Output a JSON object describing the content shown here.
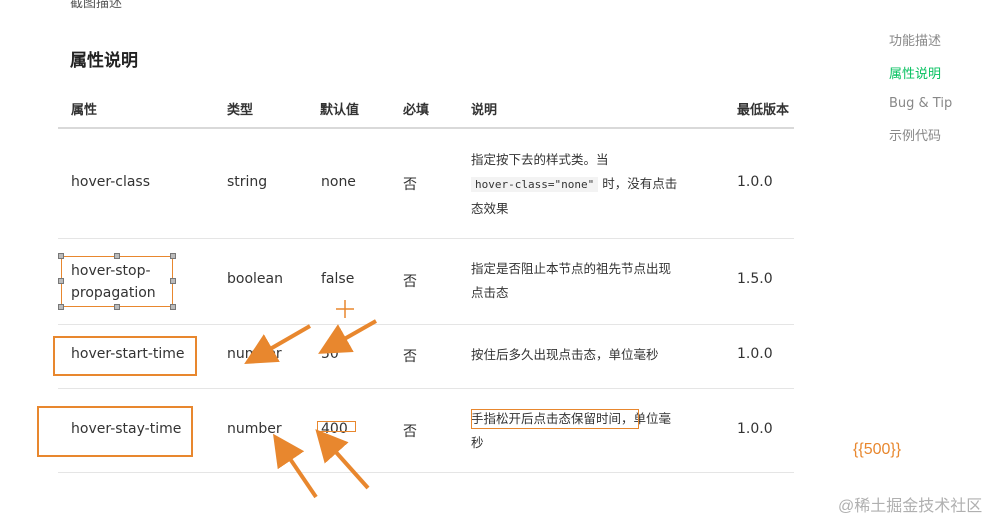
{
  "page": {
    "top_cut_text": "截图描述",
    "section_title": "属性说明"
  },
  "table": {
    "headers": [
      "属性",
      "类型",
      "默认值",
      "必填",
      "说明",
      "最低版本"
    ],
    "rows": [
      {
        "attr": "hover-class",
        "type": "string",
        "default": "none",
        "required": "否",
        "desc_pre": "指定按下去的样式类。当",
        "desc_code": "hover-class=\"none\"",
        "desc_mid": " 时，没有点击",
        "desc_post": "态效果",
        "version": "1.0.0"
      },
      {
        "attr_line1": "hover-stop-",
        "attr_line2": "propagation",
        "type": "boolean",
        "default": "false",
        "required": "否",
        "desc_line1": "指定是否阻止本节点的祖先节点出现",
        "desc_line2": "点击态",
        "version": "1.5.0"
      },
      {
        "attr": "hover-start-time",
        "type": "number",
        "default": "50",
        "required": "否",
        "desc_line1": "按住后多久出现点击态，单位毫秒",
        "version": "1.0.0"
      },
      {
        "attr": "hover-stay-time",
        "type": "number",
        "default": "400",
        "required": "否",
        "desc_line1_boxed": "手指松开后点击态保留时间",
        "desc_line1_rest": "，单位毫",
        "desc_line2": "秒",
        "version": "1.0.0"
      }
    ]
  },
  "toc": {
    "items": [
      "功能描述",
      "属性说明",
      "Bug & Tip",
      "示例代码"
    ],
    "active_index": 1
  },
  "annotation": {
    "value_label": "{{500}}",
    "accent_color": "#e8872e"
  },
  "watermark": "@稀土掘金技术社区",
  "colors": {
    "active_link": "#07c160",
    "annotation": "#e8872e"
  }
}
